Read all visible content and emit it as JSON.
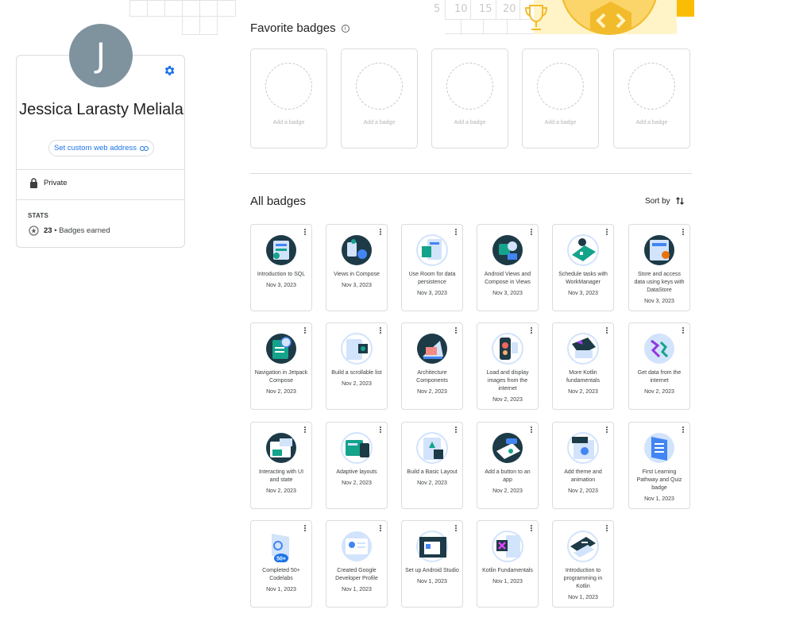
{
  "header_art": {
    "ruler_numbers": [
      "5",
      "10",
      "15",
      "20"
    ]
  },
  "profile": {
    "avatar_initial": "J",
    "name": "Jessica Larasty Meliala",
    "web_address_button": "Set custom web address",
    "privacy": "Private",
    "stats_title": "STATS",
    "badges_count": "23",
    "badges_label": "Badges earned"
  },
  "favorites": {
    "title": "Favorite badges",
    "slot_label": "Add a badge",
    "slots": [
      "Add a badge",
      "Add a badge",
      "Add a badge",
      "Add a badge",
      "Add a badge"
    ]
  },
  "all_badges": {
    "title": "All badges",
    "sort_label": "Sort by",
    "badges": [
      {
        "title": "Introduction to SQL",
        "date": "Nov 3, 2023",
        "icon": "database-icon"
      },
      {
        "title": "Views in Compose",
        "date": "Nov 3, 2023",
        "icon": "compose-views-icon"
      },
      {
        "title": "Use Room for data persistence",
        "date": "Nov 3, 2023",
        "icon": "room-database-icon"
      },
      {
        "title": "Android Views and Compose in Views",
        "date": "Nov 3, 2023",
        "icon": "android-views-icon"
      },
      {
        "title": "Schedule tasks with WorkManager",
        "date": "Nov 3, 2023",
        "icon": "workmanager-icon"
      },
      {
        "title": "Store and access data using keys with DataStore",
        "date": "Nov 3, 2023",
        "icon": "datastore-icon"
      },
      {
        "title": "Navigation in Jetpack Compose",
        "date": "Nov 2, 2023",
        "icon": "navigation-icon"
      },
      {
        "title": "Build a scrollable list",
        "date": "Nov 2, 2023",
        "icon": "scrollable-list-icon"
      },
      {
        "title": "Architecture Components",
        "date": "Nov 2, 2023",
        "icon": "architecture-icon"
      },
      {
        "title": "Load and display images from the internet",
        "date": "Nov 2, 2023",
        "icon": "images-icon"
      },
      {
        "title": "More Kotlin fundamentals",
        "date": "Nov 2, 2023",
        "icon": "kotlin-more-icon"
      },
      {
        "title": "Get data from the internet",
        "date": "Nov 2, 2023",
        "icon": "internet-data-icon"
      },
      {
        "title": "Interacting with UI and state",
        "date": "Nov 2, 2023",
        "icon": "ui-state-icon"
      },
      {
        "title": "Adaptive layouts",
        "date": "Nov 2, 2023",
        "icon": "adaptive-layouts-icon"
      },
      {
        "title": "Build a Basic Layout",
        "date": "Nov 2, 2023",
        "icon": "basic-layout-icon"
      },
      {
        "title": "Add a button to an app",
        "date": "Nov 2, 2023",
        "icon": "button-app-icon"
      },
      {
        "title": "Add theme and animation",
        "date": "Nov 2, 2023",
        "icon": "theme-animation-icon"
      },
      {
        "title": "First Learning Pathway and Quiz badge",
        "date": "Nov 1, 2023",
        "icon": "learning-pathway-icon"
      },
      {
        "title": "Completed 50+ Codelabs",
        "date": "Nov 1, 2023",
        "icon": "codelabs-50-icon"
      },
      {
        "title": "Created Google Developer Profile",
        "date": "Nov 1, 2023",
        "icon": "developer-profile-icon"
      },
      {
        "title": "Set up Android Studio",
        "date": "Nov 1, 2023",
        "icon": "android-studio-icon"
      },
      {
        "title": "Kotlin Fundamentals",
        "date": "Nov 1, 2023",
        "icon": "kotlin-fundamentals-icon"
      },
      {
        "title": "Introduction to programming in Kotlin",
        "date": "Nov 1, 2023",
        "icon": "kotlin-intro-icon"
      }
    ],
    "codelabs_badge_text": "50+"
  },
  "colors": {
    "accent": "#1a73e8",
    "avatar_bg": "#7f939e",
    "badge_dark": "#1d3a47",
    "badge_teal": "#14a38b",
    "badge_light_blue": "#d2e3fc",
    "badge_blue": "#4285f4",
    "deco_yellow": "#fbbc04"
  }
}
